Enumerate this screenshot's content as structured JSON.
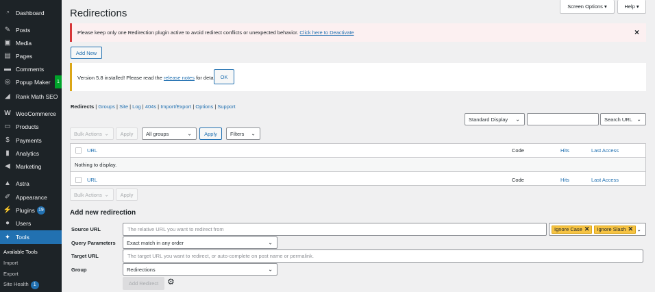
{
  "sidebar": {
    "items": [
      {
        "label": "Dashboard",
        "icon": "dashboard-icon"
      },
      {
        "label": "Posts",
        "icon": "pin-icon"
      },
      {
        "label": "Media",
        "icon": "media-icon"
      },
      {
        "label": "Pages",
        "icon": "pages-icon"
      },
      {
        "label": "Comments",
        "icon": "comments-icon"
      },
      {
        "label": "Popup Maker",
        "icon": "popup-icon",
        "badge": "1"
      },
      {
        "label": "Rank Math SEO",
        "icon": "rankmath-icon"
      },
      {
        "label": "WooCommerce",
        "icon": "woocommerce-icon"
      },
      {
        "label": "Products",
        "icon": "products-icon"
      },
      {
        "label": "Payments",
        "icon": "payments-icon"
      },
      {
        "label": "Analytics",
        "icon": "analytics-icon"
      },
      {
        "label": "Marketing",
        "icon": "marketing-icon"
      },
      {
        "label": "Astra",
        "icon": "astra-icon"
      },
      {
        "label": "Appearance",
        "icon": "appearance-icon"
      },
      {
        "label": "Plugins",
        "icon": "plugins-icon",
        "badge": "19"
      },
      {
        "label": "Users",
        "icon": "users-icon"
      },
      {
        "label": "Tools",
        "icon": "tools-icon",
        "active": true
      }
    ],
    "subitems": [
      "Available Tools",
      "Import",
      "Export",
      "Site Health"
    ],
    "site_health_badge": "1"
  },
  "header": {
    "title": "Redirections",
    "screen_options": "Screen Options ▾",
    "help": "Help ▾"
  },
  "notice": {
    "text": "Please keep only one Redirection plugin active to avoid redirect conflicts or unexpected behavior.",
    "link": "Click here to Deactivate",
    "close": "×"
  },
  "add_new": "Add New",
  "version_notice": {
    "text_before": "Version 5.8 installed! Please read the",
    "link": "release notes",
    "text_after": "for details.",
    "ok": "OK"
  },
  "subnav": {
    "current": "Redirects",
    "links": [
      "Groups",
      "Site",
      "Log",
      "404s",
      "Import/Export",
      "Options",
      "Support"
    ],
    "sep": "|"
  },
  "toolbar": {
    "display": "Standard Display",
    "search_placeholder": "",
    "search_button": "Search URL",
    "bulk_actions": "Bulk Actions",
    "apply": "Apply",
    "groups": "All groups",
    "apply2": "Apply",
    "filters": "Filters"
  },
  "table": {
    "headers": {
      "url": "URL",
      "code": "Code",
      "hits": "Hits",
      "last_access": "Last Access"
    },
    "empty": "Nothing to display."
  },
  "bottom_toolbar": {
    "bulk_actions": "Bulk Actions",
    "apply": "Apply"
  },
  "form": {
    "heading": "Add new redirection",
    "source_label": "Source URL",
    "source_placeholder": "The relative URL you want to redirect from",
    "tag_ignore_case": "Ignore Case",
    "tag_ignore_slash": "Ignore Slash",
    "tag_x": "✕",
    "query_label": "Query Parameters",
    "query_value": "Exact match in any order",
    "target_label": "Target URL",
    "target_placeholder": "The target URL you want to redirect, or auto-complete on post name or permalink.",
    "group_label": "Group",
    "group_value": "Redirections",
    "submit": "Add Redirect"
  },
  "colors": {
    "primary": "#2271b1",
    "sidebar": "#1d2327",
    "error": "#d63638",
    "warning": "#dba617",
    "tag": "#f6c343"
  }
}
